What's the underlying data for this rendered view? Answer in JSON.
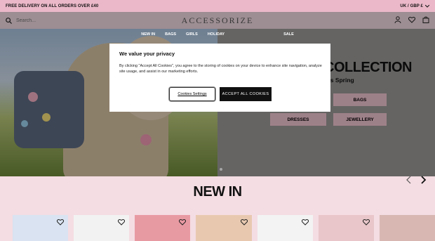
{
  "topbar": {
    "promo": "FREE DELIVERY ON ALL ORDERS OVER £40",
    "locale": "UK / GBP £"
  },
  "header": {
    "search_placeholder": "Search...",
    "logo": "ACCESSORIZE"
  },
  "nav": {
    "items": [
      "NEW IN",
      "BAGS",
      "GIRLS",
      "HOLIDAY",
      "",
      "",
      "",
      "",
      "",
      "SALE"
    ]
  },
  "hero": {
    "title": "COLLECTION",
    "subtitle": "es Spring",
    "buttons": [
      "BAGS",
      "DRESSES",
      "JEWELLERY"
    ]
  },
  "cookie_modal": {
    "title": "We value your privacy",
    "body": "By clicking \"Accept All Cookies\", you agree to the storing of cookies on your device to enhance site navigation, analyze site usage, and assist in our marketing efforts.",
    "settings_label": "Cookies Settings",
    "accept_label": "ACCEPT ALL COOKIES"
  },
  "section": {
    "title": "NEW IN"
  },
  "products": [
    {
      "bg": "#d9e3f1"
    },
    {
      "bg": "#f2f2f2"
    },
    {
      "bg": "#e89aa3"
    },
    {
      "bg": "#e8c9b0"
    },
    {
      "bg": "#f3f3f3"
    },
    {
      "bg": "#e8c6c9"
    },
    {
      "bg": "#d8b7b2"
    }
  ],
  "colors": {
    "promo_bar": "#eab8c8",
    "page_bg": "#f4dde3",
    "hero_button": "#f2c6d3",
    "accept": "#111111"
  }
}
